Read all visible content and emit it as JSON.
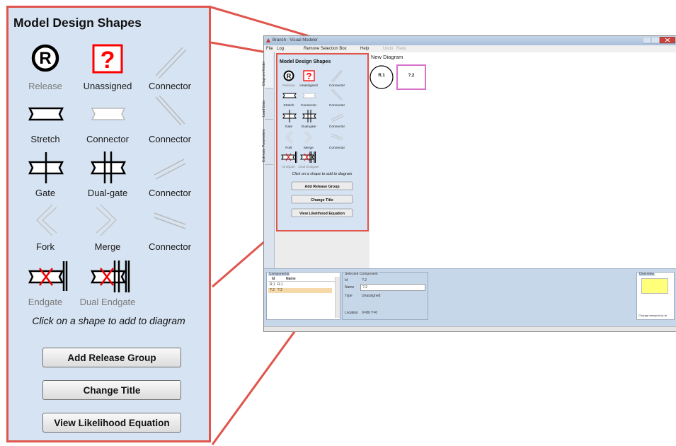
{
  "colors": {
    "accent": "#e0554c",
    "panel_bg": "#d6e3f2",
    "node_pink": "#d872c9",
    "overview_yellow": "#ffff7a"
  },
  "panel": {
    "title": "Model Design Shapes",
    "shapes": [
      {
        "label": "Release",
        "icon": "release-icon",
        "enabled": false
      },
      {
        "label": "Unassigned",
        "icon": "unassigned-icon",
        "enabled": true
      },
      {
        "label": "Connector",
        "icon": "connector-icon",
        "enabled": true
      },
      {
        "label": "Stretch",
        "icon": "stretch-icon",
        "enabled": true
      },
      {
        "label": "Connector",
        "icon": "connector-icon",
        "enabled": true
      },
      {
        "label": "Connector",
        "icon": "connector-icon",
        "enabled": true
      },
      {
        "label": "Gate",
        "icon": "gate-icon",
        "enabled": true
      },
      {
        "label": "Dual-gate",
        "icon": "dual-gate-icon",
        "enabled": true
      },
      {
        "label": "Connector",
        "icon": "connector-icon",
        "enabled": true
      },
      {
        "label": "Fork",
        "icon": "fork-icon",
        "enabled": true
      },
      {
        "label": "Merge",
        "icon": "merge-icon",
        "enabled": true
      },
      {
        "label": "Connector",
        "icon": "connector-icon",
        "enabled": true
      },
      {
        "label": "Endgate",
        "icon": "endgate-icon",
        "enabled": false
      },
      {
        "label": "Dual Endgate",
        "icon": "dual-endgate-icon",
        "enabled": false
      }
    ],
    "hint": "Click on a shape to add to diagram",
    "buttons": {
      "add_release_group": "Add Release Group",
      "change_title": "Change Title",
      "view_likelihood": "View Likelihood Equation"
    }
  },
  "app": {
    "title": "Branch - Visual Modeler",
    "menu": {
      "file": "File",
      "log": "Log",
      "remove_selection": "Remove Selection Box",
      "help": "Help",
      "undo": "Undo",
      "redo": "Redo"
    },
    "side_tabs": [
      "Diagram Model",
      "Load Data",
      "Estimate Parameters"
    ],
    "diagram_title": "New Diagram",
    "nodes": {
      "release": "R.1",
      "unassigned": "?.2"
    },
    "components": {
      "title": "Components",
      "headers": {
        "id": "Id",
        "name": "Name"
      },
      "rows": [
        {
          "id": "R.1",
          "name": "R.1"
        },
        {
          "id": "?.2",
          "name": "?.2"
        }
      ]
    },
    "selected_component": {
      "title": "Selected Component",
      "id_label": "Id",
      "id_value": "?.2",
      "name_label": "Name",
      "name_value": "?.2",
      "type_label": "Type",
      "type_value": "Unassigned",
      "location_label": "Location",
      "location_value": "X=80 Y=0"
    },
    "overview": {
      "title": "Overview",
      "caption": "Change viewport by dr"
    }
  }
}
